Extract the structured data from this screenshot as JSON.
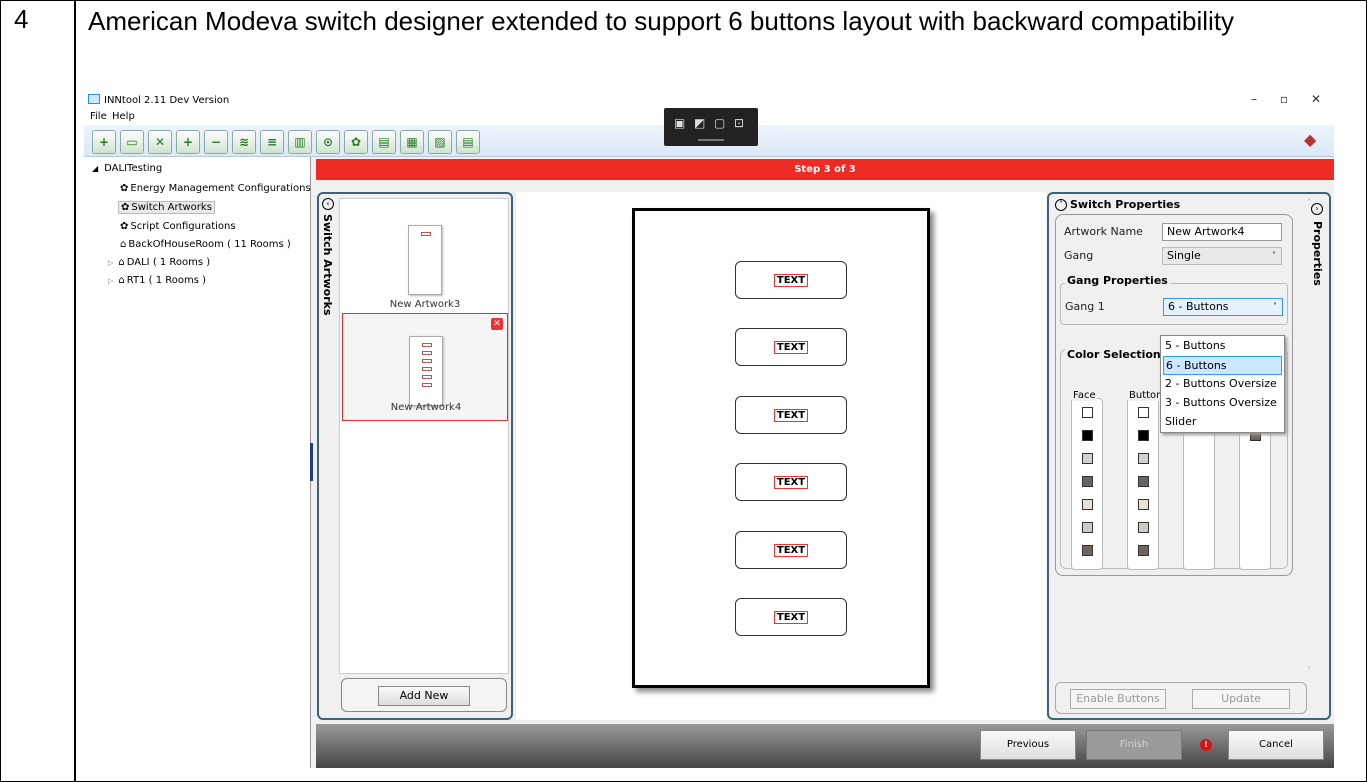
{
  "row": {
    "number": "4",
    "description": "American Modeva switch designer extended to support 6 buttons layout with backward compatibility"
  },
  "window": {
    "title": "INNtool 2.11 Dev Version",
    "minimize": "–",
    "maximize": "▫",
    "close": "✕"
  },
  "menu": {
    "file": "File",
    "help": "Help"
  },
  "toolbar_icons": [
    "new-icon",
    "open-icon",
    "delete-doc-icon",
    "add-icon",
    "remove-icon",
    "wireless-icon",
    "script-icon",
    "chart-icon",
    "download-icon",
    "settings-icon",
    "folder-icon",
    "export-icon",
    "disabled-icon",
    "document-icon"
  ],
  "tree": {
    "root": "DALITesting",
    "items": [
      "Energy Management Configurations",
      "Switch Artworks",
      "Script Configurations",
      "BackOfHouseRoom ( 11 Rooms )",
      "DALI ( 1 Rooms )",
      "RT1 ( 1 Rooms )"
    ]
  },
  "step_banner": "Step 3 of 3",
  "artworks": {
    "panel_title": "Switch Artworks",
    "items": [
      "New Artwork3",
      "New Artwork4"
    ],
    "add_new": "Add New"
  },
  "plate": {
    "button_text": [
      "TEXT",
      "TEXT",
      "TEXT",
      "TEXT",
      "TEXT",
      "TEXT"
    ]
  },
  "properties": {
    "panel_title": "Properties",
    "header": "Switch Properties",
    "artwork_name_label": "Artwork Name",
    "artwork_name_value": "New Artwork4",
    "gang_label": "Gang",
    "gang_value": "Single",
    "gang_props_title": "Gang Properties",
    "gang1_label": "Gang 1",
    "gang1_value": "6 - Buttons",
    "dropdown_options": [
      "5 - Buttons",
      "6 - Buttons",
      "2 - Buttons Oversize",
      "3 - Buttons Oversize",
      "Slider"
    ],
    "dropdown_highlighted": "6 - Buttons",
    "color_selection_title": "Color Selection",
    "face_label": "Face",
    "button_label": "Button",
    "face_colors": [
      "#ffffff",
      "#000000",
      "#d4d2ce",
      "#636466",
      "#e9e2d4",
      "#cfcac4",
      "#6e645c"
    ],
    "button_colors": [
      "#ffffff",
      "#000000",
      "#d4d2ce",
      "#636466",
      "#e9e2d4",
      "#cfcac4",
      "#6e645c"
    ],
    "col3_colors": [
      "#ffffff"
    ],
    "col4_colors": [
      "#cfcac4",
      "#6e645c"
    ],
    "enable_buttons": "Enable Buttons",
    "update": "Update"
  },
  "footer": {
    "previous": "Previous",
    "finish": "Finish",
    "error_mark": "!",
    "cancel": "Cancel"
  }
}
